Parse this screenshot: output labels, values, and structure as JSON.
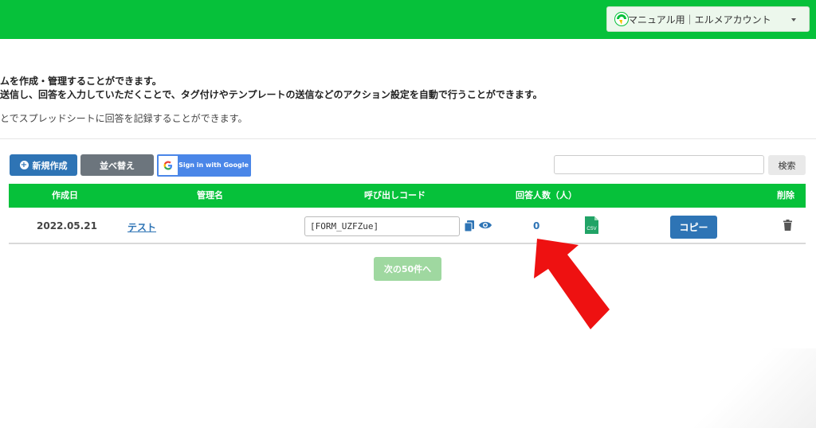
{
  "header": {
    "account_label": "マニュアル用｜エルメアカウント"
  },
  "description": {
    "line1": "ムを作成・管理することができます。",
    "line2": "送信し、回答を入力していただくことで、タグ付けやテンプレートの送信などのアクション設定を自動で行うことができます。",
    "line3": "とでスプレッドシートに回答を記録することができます。"
  },
  "toolbar": {
    "new_label": "新規作成",
    "sort_label": "並べ替え",
    "google_label": "Sign in with Google",
    "search_placeholder": "",
    "search_label": "検索"
  },
  "table": {
    "headers": {
      "created": "作成日",
      "name": "管理名",
      "code": "呼び出しコード",
      "responses": "回答人数（人）",
      "delete": "削除"
    },
    "rows": [
      {
        "created": "2022.05.21",
        "name": "テスト",
        "code": "[FORM_UZFZue]",
        "responses": "0",
        "csv_label": "CSV",
        "copy_label": "コピー"
      }
    ]
  },
  "pagination": {
    "next_label": "次の50件へ"
  },
  "colors": {
    "brand_green": "#06c13a",
    "primary_blue": "#2e74b5",
    "annotation_red": "#ee1111"
  }
}
